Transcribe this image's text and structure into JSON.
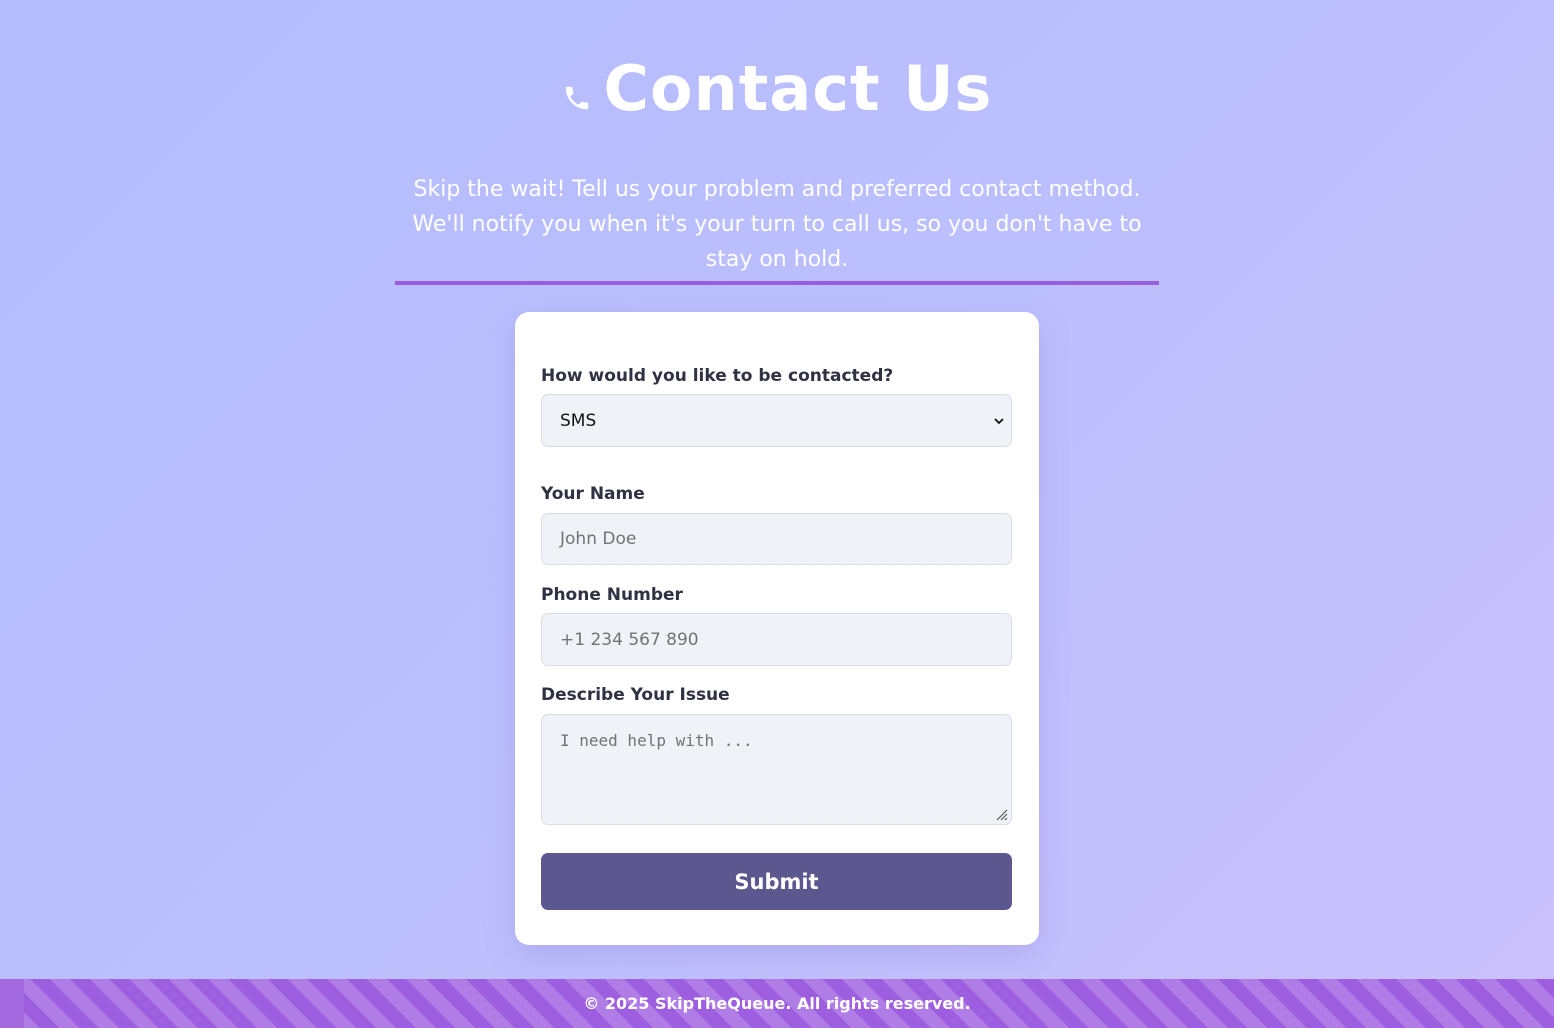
{
  "header": {
    "title": "Contact Us",
    "icon": "phone-icon",
    "subtitle": "Skip the wait! Tell us your problem and preferred contact method. We'll notify you when it's your turn to call us, so you don't have to stay on hold."
  },
  "form": {
    "contact_method": {
      "label": "How would you like to be contacted?",
      "value": "SMS"
    },
    "name": {
      "label": "Your Name",
      "placeholder": "John Doe"
    },
    "phone": {
      "label": "Phone Number",
      "placeholder": "+1 234 567 890"
    },
    "issue": {
      "label": "Describe Your Issue",
      "placeholder": "I need help with ..."
    },
    "submit_label": "Submit"
  },
  "footer": {
    "text": "© 2025 SkipTheQueue. All rights reserved."
  },
  "colors": {
    "accent": "#9b5de0",
    "button": "#5c588f",
    "card": "#ffffff",
    "input_bg": "#eff3f7"
  }
}
